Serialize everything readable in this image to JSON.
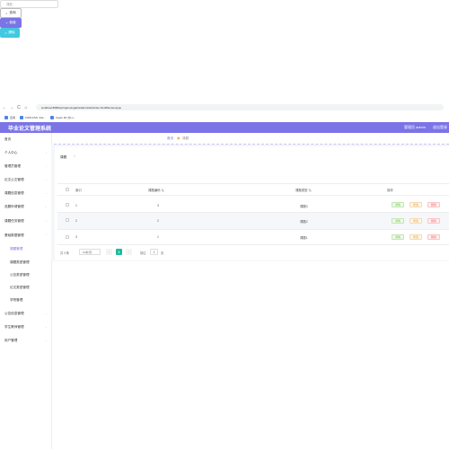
{
  "browser": {
    "nav_back": "←",
    "nav_forward": "→",
    "nav_reload": "C",
    "nav_home": "⌂",
    "url": "localhost:8080/springbootxga2u/admin/dist/index.html#/lunwentype",
    "bookmarks": [
      {
        "label": "应用"
      },
      {
        "label": "100%CSS: 3ds..."
      },
      {
        "label": "Capto 3D 文Lu..."
      }
    ]
  },
  "header": {
    "title": "毕业论文管理系统",
    "user": "管理员 admin",
    "logout": "退出登录"
  },
  "sidebar": {
    "items": [
      {
        "label": "首页"
      },
      {
        "label": "个人中心"
      },
      {
        "label": "管理员管理"
      },
      {
        "label": "论文公文管理"
      },
      {
        "label": "课题信息管理"
      },
      {
        "label": "选题申请管理"
      },
      {
        "label": "课题任务管理"
      },
      {
        "label": "基础数据管理"
      }
    ],
    "subitems": [
      {
        "label": "课题管理"
      },
      {
        "label": "课题类型管理"
      },
      {
        "label": "公告类型管理"
      },
      {
        "label": "论文类型管理"
      },
      {
        "label": "学院管理"
      }
    ],
    "bottom_items": [
      {
        "label": "公告信息管理"
      },
      {
        "label": "学生教师管理"
      },
      {
        "label": "用户管理"
      }
    ]
  },
  "breadcrumb": {
    "home": "首页",
    "current": "课题"
  },
  "search": {
    "label": "课题",
    "placeholder": "课题",
    "button": "查询"
  },
  "toolbar": {
    "add": "新增",
    "delete": "删除"
  },
  "table": {
    "headers": [
      "索引",
      "课题编码",
      "课题类型",
      "操作"
    ],
    "rows": [
      {
        "index": "1",
        "code": "3",
        "type": "课题3"
      },
      {
        "index": "2",
        "code": "2",
        "type": "课题2"
      },
      {
        "index": "3",
        "code": "1",
        "type": "课题1"
      }
    ],
    "actions": {
      "view": "详情",
      "edit": "修改",
      "delete": "删除"
    }
  },
  "pagination": {
    "total": "共 3 条",
    "page_size": "10条/页",
    "current_page": "1",
    "goto_label": "前往",
    "jump_value": "1",
    "page_label": "页"
  },
  "colors": {
    "accent": "#7b74e6",
    "info": "#42c9e0",
    "page_active": "#1abc9c"
  }
}
